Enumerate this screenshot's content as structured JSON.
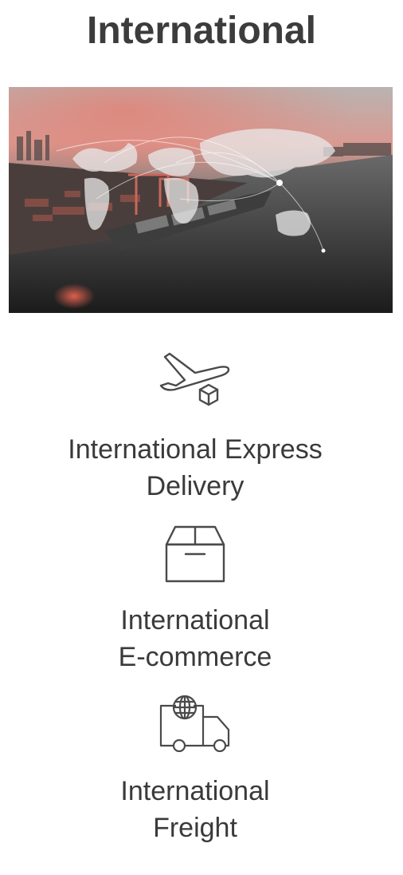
{
  "page": {
    "title": "International"
  },
  "hero_image": {
    "description": "world-map-over-port-image"
  },
  "services": [
    {
      "icon": "airplane-package-icon",
      "label": "International Express\nDelivery"
    },
    {
      "icon": "box-icon",
      "label": "International\nE-commerce"
    },
    {
      "icon": "globe-truck-icon",
      "label": "International\nFreight"
    }
  ],
  "colors": {
    "text": "#3a3a3a",
    "accent": "#e8685a",
    "icon_stroke": "#4a4a4a"
  }
}
